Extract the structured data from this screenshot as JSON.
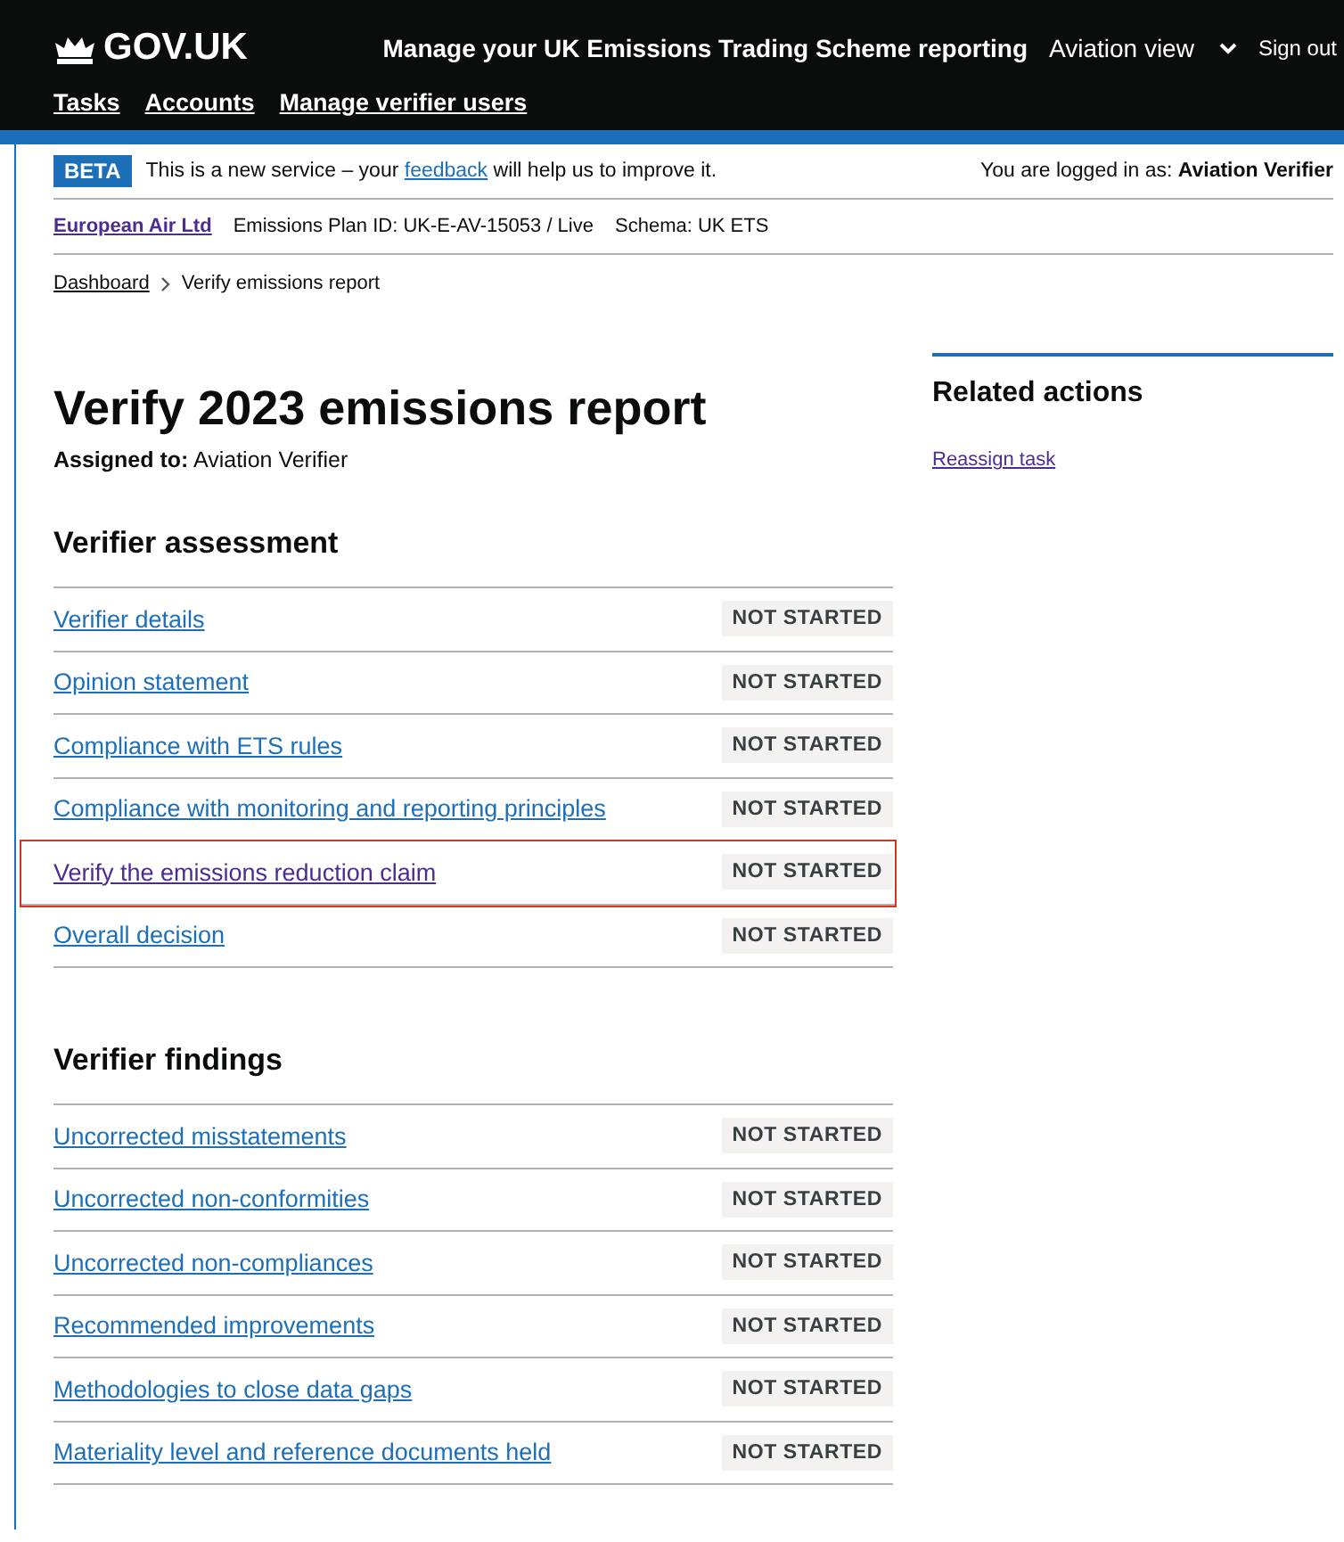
{
  "header": {
    "logo": "GOV.UK",
    "service": "Manage your UK Emissions Trading Scheme reporting",
    "view": "Aviation view",
    "sign_out": "Sign out",
    "nav": [
      "Tasks",
      "Accounts",
      "Manage verifier users"
    ]
  },
  "banner": {
    "tag": "BETA",
    "before": "This is a new service – your",
    "link": "feedback",
    "after": "will help us to improve it.",
    "logged_in": "You are logged in as: **Aviation Verifier**"
  },
  "account": {
    "name": "European Air Ltd",
    "plan": "Emissions Plan ID: UK-E-AV-15053 / Live",
    "schema": "Schema: UK ETS"
  },
  "breadcrumbs": {
    "link": "Dashboard",
    "current": "Verify emissions report"
  },
  "title": "Verify 2023 emissions report",
  "assigned": "**Assigned to:** Aviation Verifier",
  "sections": [
    {
      "heading": "Verifier assessment",
      "tasks": [
        {
          "label": "Verifier details",
          "status": "NOT STARTED",
          "highlighted": false
        },
        {
          "label": "Opinion statement",
          "status": "NOT STARTED",
          "highlighted": false
        },
        {
          "label": "Compliance with ETS rules",
          "status": "NOT STARTED",
          "highlighted": false
        },
        {
          "label": "Compliance with monitoring and reporting principles",
          "status": "NOT STARTED",
          "highlighted": false
        },
        {
          "label": "Verify the emissions reduction claim",
          "status": "NOT STARTED",
          "highlighted": true
        },
        {
          "label": "Overall decision",
          "status": "NOT STARTED",
          "highlighted": false
        }
      ]
    },
    {
      "heading": "Verifier findings",
      "tasks": [
        {
          "label": "Uncorrected misstatements",
          "status": "NOT STARTED",
          "highlighted": false
        },
        {
          "label": "Uncorrected non-conformities",
          "status": "NOT STARTED",
          "highlighted": false
        },
        {
          "label": "Uncorrected non-compliances",
          "status": "NOT STARTED",
          "highlighted": false
        },
        {
          "label": "Recommended improvements",
          "status": "NOT STARTED",
          "highlighted": false
        },
        {
          "label": "Methodologies to close data gaps",
          "status": "NOT STARTED",
          "highlighted": false
        },
        {
          "label": "Materiality level and reference documents held",
          "status": "NOT STARTED",
          "highlighted": false
        }
      ]
    }
  ],
  "related": {
    "heading": "Related actions",
    "links": [
      "Reassign task"
    ]
  }
}
